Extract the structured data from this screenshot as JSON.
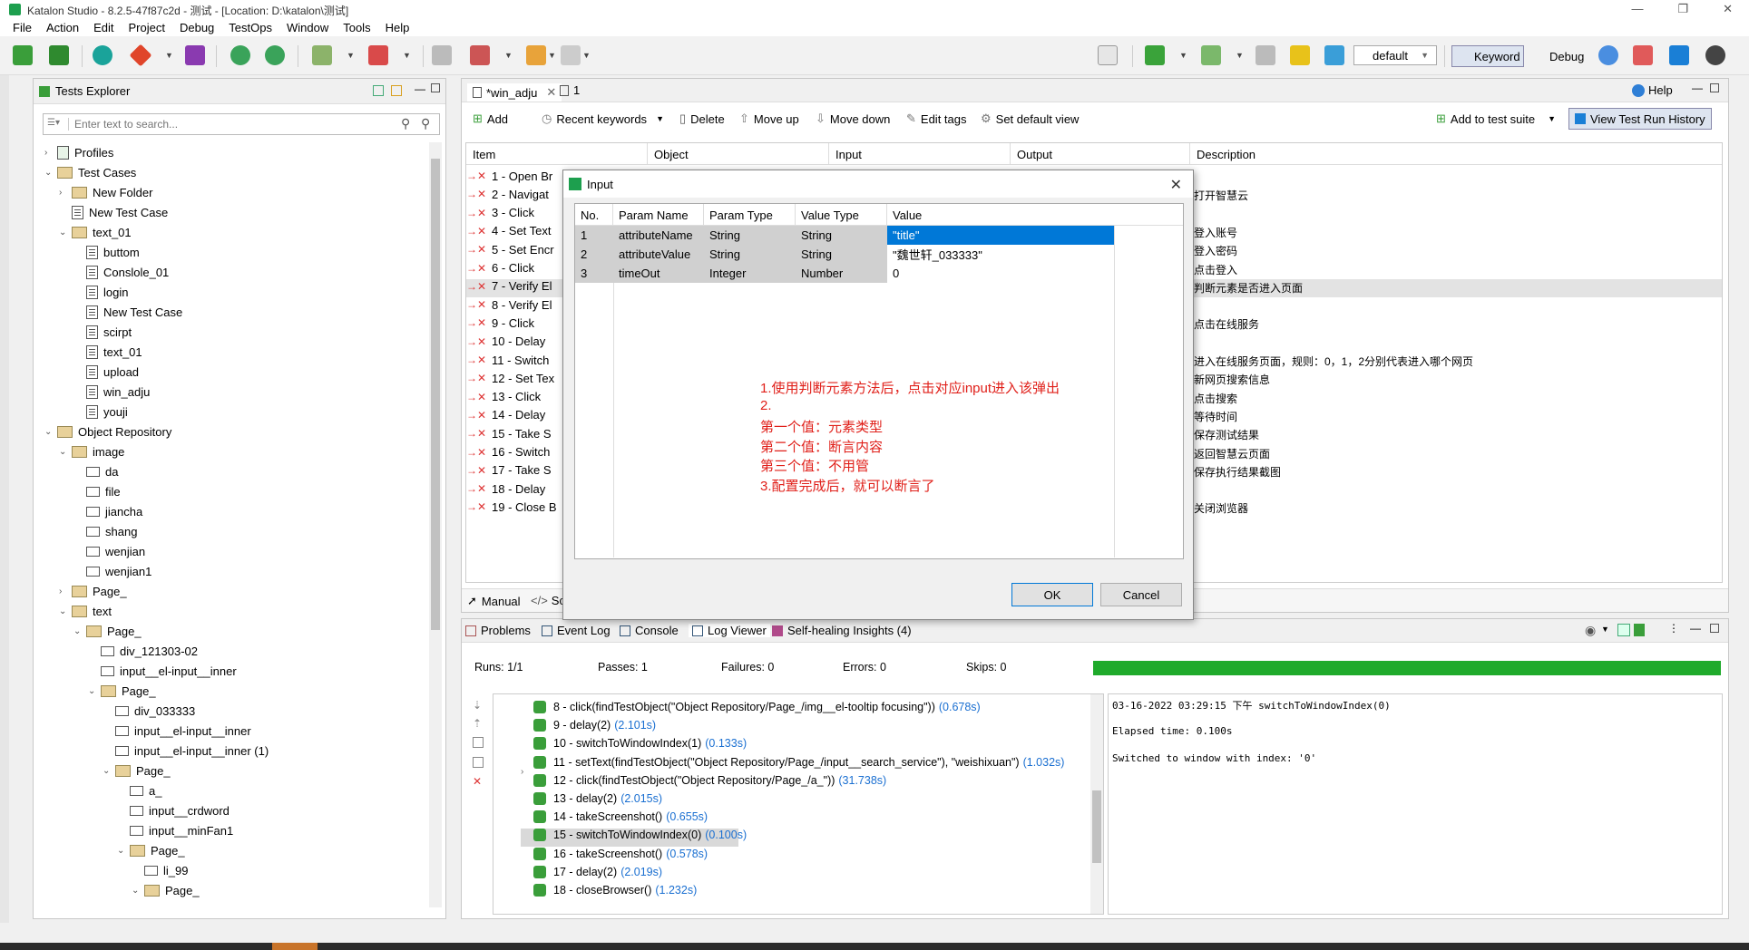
{
  "window": {
    "title": "Katalon Studio - 8.2.5-47f87c2d - 测试 - [Location: D:\\katalon\\测试]",
    "minimize": "—",
    "maximize": "❐",
    "close": "✕"
  },
  "menu": [
    "File",
    "Action",
    "Edit",
    "Project",
    "Debug",
    "TestOps",
    "Window",
    "Tools",
    "Help"
  ],
  "toolbar": {
    "profile_select": "default",
    "keyword_label": "Keyword",
    "debug_label": "Debug"
  },
  "explorer": {
    "tab_label": "Tests Explorer",
    "search_placeholder": "Enter text to search...",
    "items": [
      {
        "label": "Profiles",
        "icon": "profile",
        "arrow": "›"
      },
      {
        "label": "Test Cases",
        "icon": "folder",
        "arrow": "⌄"
      },
      {
        "label": "New Folder",
        "icon": "folder",
        "arrow": "›"
      },
      {
        "label": "New Test Case",
        "icon": "testcase",
        "arrow": ""
      },
      {
        "label": "text_01",
        "icon": "folder",
        "arrow": "⌄"
      },
      {
        "label": "buttom",
        "icon": "testcase",
        "arrow": ""
      },
      {
        "label": "Conslole_01",
        "icon": "testcase",
        "arrow": ""
      },
      {
        "label": "login",
        "icon": "testcase",
        "arrow": ""
      },
      {
        "label": "New Test Case",
        "icon": "testcase",
        "arrow": ""
      },
      {
        "label": "scirpt",
        "icon": "testcase",
        "arrow": ""
      },
      {
        "label": "text_01",
        "icon": "testcase",
        "arrow": ""
      },
      {
        "label": "upload",
        "icon": "testcase",
        "arrow": ""
      },
      {
        "label": "win_adju",
        "icon": "testcase",
        "arrow": ""
      },
      {
        "label": "youji",
        "icon": "testcase",
        "arrow": ""
      },
      {
        "label": "Object Repository",
        "icon": "folder",
        "arrow": "⌄"
      },
      {
        "label": "image",
        "icon": "folder",
        "arrow": "⌄"
      },
      {
        "label": "da",
        "icon": "object",
        "arrow": ""
      },
      {
        "label": "file",
        "icon": "object",
        "arrow": ""
      },
      {
        "label": "jiancha",
        "icon": "object",
        "arrow": ""
      },
      {
        "label": "shang",
        "icon": "object",
        "arrow": ""
      },
      {
        "label": "wenjian",
        "icon": "object",
        "arrow": ""
      },
      {
        "label": "wenjian1",
        "icon": "object",
        "arrow": ""
      },
      {
        "label": "Page_",
        "icon": "folder",
        "arrow": "›"
      },
      {
        "label": "text",
        "icon": "folder",
        "arrow": "⌄"
      },
      {
        "label": "Page_",
        "icon": "folder",
        "arrow": "⌄"
      },
      {
        "label": "div_121303-02",
        "icon": "object",
        "arrow": ""
      },
      {
        "label": "input__el-input__inner",
        "icon": "object",
        "arrow": ""
      },
      {
        "label": "Page_",
        "icon": "folder",
        "arrow": "⌄"
      },
      {
        "label": "div_033333",
        "icon": "object",
        "arrow": ""
      },
      {
        "label": "input__el-input__inner",
        "icon": "object",
        "arrow": ""
      },
      {
        "label": "input__el-input__inner (1)",
        "icon": "object",
        "arrow": ""
      },
      {
        "label": "Page_",
        "icon": "folder",
        "arrow": "⌄"
      },
      {
        "label": "a_",
        "icon": "link",
        "arrow": ""
      },
      {
        "label": "input__crdword",
        "icon": "object",
        "arrow": ""
      },
      {
        "label": "input__minFan1",
        "icon": "object",
        "arrow": ""
      },
      {
        "label": "Page_",
        "icon": "folder",
        "arrow": "⌄"
      },
      {
        "label": "li_99",
        "icon": "object",
        "arrow": ""
      },
      {
        "label": "Page_",
        "icon": "folder",
        "arrow": "⌄"
      }
    ]
  },
  "editor": {
    "tab_label": "*win_adju",
    "tab2_label": "1",
    "help_label": "Help",
    "actions": {
      "add": "Add",
      "recent": "Recent keywords",
      "delete": "Delete",
      "move_up": "Move up",
      "move_down": "Move down",
      "edit_tags": "Edit tags",
      "default_view": "Set default view",
      "add_suite": "Add to test suite",
      "history": "View Test Run History"
    },
    "columns": [
      "Item",
      "Object",
      "Input",
      "Output",
      "Description"
    ],
    "steps": [
      "1 - Open Br",
      "2 - Navigat",
      "3 - Click",
      "4 - Set Text",
      "5 - Set Encr",
      "6 - Click",
      "7 - Verify El",
      "8 - Verify El",
      "9 - Click",
      "10 - Delay",
      "11 - Switch",
      "12 - Set Tex",
      "13 - Click",
      "14 - Delay",
      "15 - Take S",
      "16 - Switch",
      "17 - Take S",
      "18 - Delay",
      "19 - Close B"
    ],
    "descriptions": [
      "",
      "打开智慧云",
      "",
      "登入账号",
      "登入密码",
      "点击登入",
      "判断元素是否进入页面",
      "",
      "点击在线服务",
      "",
      "进入在线服务页面，规则：0，1，2分别代表进入哪个网页",
      "新网页搜索信息",
      "点击搜索",
      "等待时间",
      "保存测试结果",
      "返回智慧云页面",
      "保存执行结果截图",
      "",
      "关闭浏览器"
    ],
    "bottom_tabs": [
      "Manual",
      "Scr"
    ]
  },
  "dialog": {
    "title": "Input",
    "columns": [
      "No.",
      "Param Name",
      "Param Type",
      "Value Type",
      "Value"
    ],
    "rows": [
      {
        "no": "1",
        "name": "attributeName",
        "ptype": "String",
        "vtype": "String",
        "value": "\"title\""
      },
      {
        "no": "2",
        "name": "attributeValue",
        "ptype": "String",
        "vtype": "String",
        "value": "\"魏世轩_033333\""
      },
      {
        "no": "3",
        "name": "timeOut",
        "ptype": "Integer",
        "vtype": "Number",
        "value": "0"
      }
    ],
    "notes": [
      "1.使用判断元素方法后，点击对应input进入该弹出",
      "2.",
      "第一个值：元素类型",
      "第二个值：断言内容",
      "第三个值：不用管",
      "3.配置完成后，就可以断言了"
    ],
    "ok": "OK",
    "cancel": "Cancel"
  },
  "bottom": {
    "tabs": [
      "Problems",
      "Event Log",
      "Console",
      "Log Viewer",
      "Self-healing Insights (4)"
    ],
    "stats": {
      "runs": "Runs: 1/1",
      "passes": "Passes: 1",
      "failures": "Failures: 0",
      "errors": "Errors: 0",
      "skips": "Skips: 0"
    },
    "progress": 1.0,
    "log": [
      {
        "text": "8 - click(findTestObject(\"Object Repository/Page_/img__el-tooltip focusing\"))",
        "time": "(0.678s)"
      },
      {
        "text": "9 - delay(2)",
        "time": "(2.101s)"
      },
      {
        "text": "10 - switchToWindowIndex(1)",
        "time": "(0.133s)"
      },
      {
        "text": "11 - setText(findTestObject(\"Object Repository/Page_/input__search_service\"), \"weishixuan\")",
        "time": "(1.032s)"
      },
      {
        "text": "12 - click(findTestObject(\"Object Repository/Page_/a_\"))",
        "time": "(31.738s)"
      },
      {
        "text": "13 - delay(2)",
        "time": "(2.015s)"
      },
      {
        "text": "14 - takeScreenshot()",
        "time": "(0.655s)"
      },
      {
        "text": "15 - switchToWindowIndex(0)",
        "time": "(0.100s)"
      },
      {
        "text": "16 - takeScreenshot()",
        "time": "(0.578s)"
      },
      {
        "text": "17 - delay(2)",
        "time": "(2.019s)"
      },
      {
        "text": "18 - closeBrowser()",
        "time": "(1.232s)"
      }
    ],
    "console_lines": [
      "03-16-2022 03:29:15 下午 switchToWindowIndex(0)",
      "Elapsed time: 0.100s",
      "Switched to window with index: '0'"
    ]
  },
  "colors": {
    "accent": "#0078d7",
    "progress": "#1faa2b",
    "note_red": "#e0201a",
    "selection": "#d9d9d9"
  }
}
